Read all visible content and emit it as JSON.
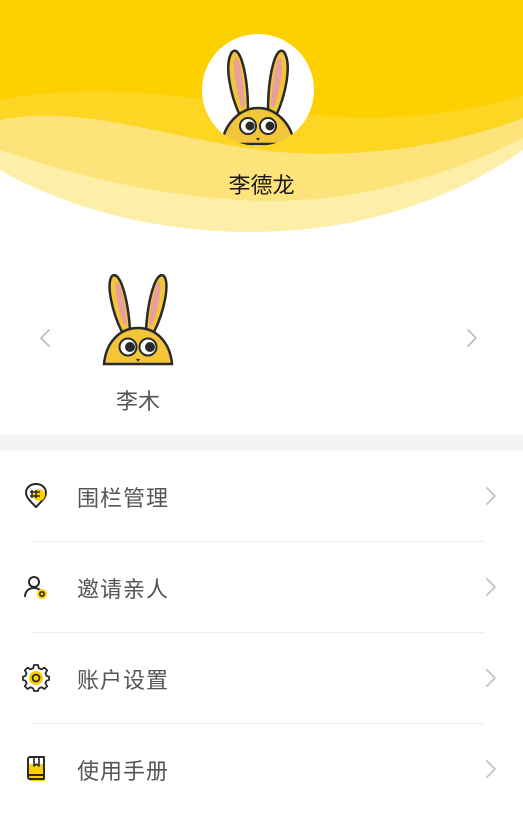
{
  "profile": {
    "name": "李德龙",
    "avatar_icon": "rabbit-avatar-icon"
  },
  "carousel": {
    "members": [
      {
        "name": "李木",
        "avatar_icon": "rabbit-avatar-icon"
      }
    ],
    "prev_icon": "chevron-left-icon",
    "next_icon": "chevron-right-icon"
  },
  "menu": {
    "items": [
      {
        "label": "围栏管理",
        "icon": "fence-location-icon"
      },
      {
        "label": "邀请亲人",
        "icon": "invite-user-icon"
      },
      {
        "label": "账户设置",
        "icon": "gear-icon"
      },
      {
        "label": "使用手册",
        "icon": "manual-book-icon"
      }
    ]
  },
  "colors": {
    "accent": "#FDD000",
    "accent_light": "#FEE585",
    "text_primary": "#1A1A1A",
    "text_secondary": "#555555",
    "separator": "#ECECEC"
  }
}
